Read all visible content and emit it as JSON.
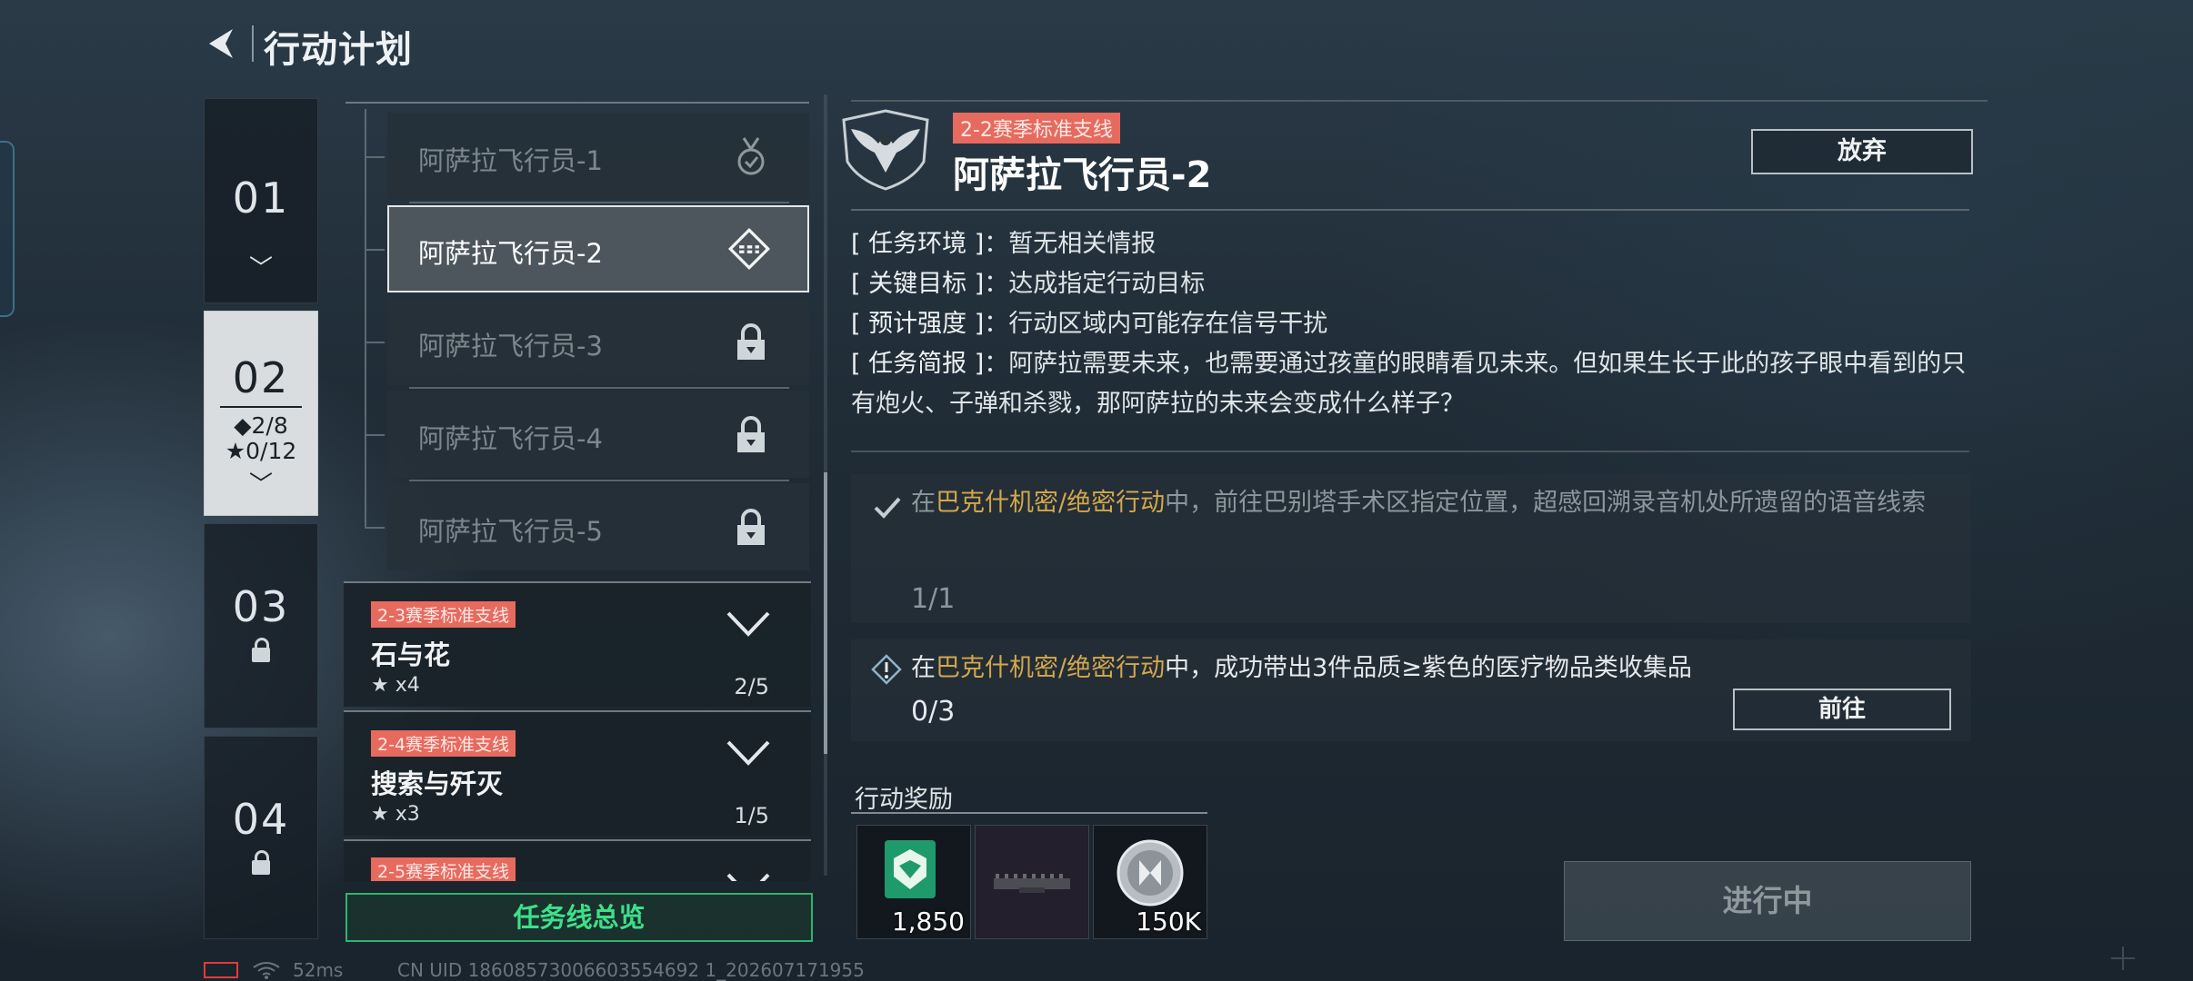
{
  "header": {
    "title": "行动计划"
  },
  "chapters": [
    {
      "num": "01",
      "state": "unlocked"
    },
    {
      "num": "02",
      "diamond": "◆2/8",
      "star": "★0/12",
      "state": "active"
    },
    {
      "num": "03",
      "state": "locked"
    },
    {
      "num": "04",
      "state": "locked"
    }
  ],
  "sub_missions": [
    {
      "label": "阿萨拉飞行员-1",
      "state": "completed"
    },
    {
      "label": "阿萨拉飞行员-2",
      "state": "selected"
    },
    {
      "label": "阿萨拉飞行员-3",
      "state": "locked"
    },
    {
      "label": "阿萨拉飞行员-4",
      "state": "locked"
    },
    {
      "label": "阿萨拉飞行员-5",
      "state": "locked"
    }
  ],
  "mission_cards": [
    {
      "tag": "2-3赛季标准支线",
      "title": "石与花",
      "stars": "★ x4",
      "progress": "2/5"
    },
    {
      "tag": "2-4赛季标准支线",
      "title": "搜索与歼灭",
      "stars": "★ x3",
      "progress": "1/5"
    },
    {
      "tag": "2-5赛季标准支线"
    }
  ],
  "overview_label": "任务线总览",
  "detail": {
    "tag": "2-2赛季标准支线",
    "title": "阿萨拉飞行员-2",
    "abandon_label": "放弃",
    "info": [
      {
        "key": "[ 任务环境 ]",
        "value": "暂无相关情报"
      },
      {
        "key": "[ 关键目标 ]",
        "value": "达成指定行动目标"
      },
      {
        "key": "[ 预计强度 ]",
        "value": "行动区域内可能存在信号干扰"
      },
      {
        "key": "[ 任务简报 ]",
        "value": "阿萨拉需要未来，也需要通过孩童的眼睛看见未来。但如果生长于此的孩子眼中看到的只有炮火、子弹和杀戮，那阿萨拉的未来会变成什么样子？"
      }
    ],
    "objectives": [
      {
        "pre": "在",
        "hl": "巴克什机密/绝密行动",
        "post": "中，前往巴别塔手术区指定位置，超感回溯录音机处所遗留的语音线索",
        "count": "1/1",
        "done": true
      },
      {
        "pre": "在",
        "hl": "巴克什机密/绝密行动",
        "post": "中，成功带出3件品质≥紫色的医疗物品类收集品",
        "count": "0/3",
        "done": false,
        "button": "前往"
      }
    ],
    "rewards_label": "行动奖励",
    "rewards": [
      {
        "icon": "green-emblem-icon",
        "amount": "1,850"
      },
      {
        "icon": "weapon-rail-icon",
        "amount": ""
      },
      {
        "icon": "silver-coin-icon",
        "amount": "150K"
      }
    ],
    "status_button": "进行中"
  },
  "status_bar": {
    "ping": "52ms",
    "uid": "CN UID 18608573006603554692 1_202607171955"
  },
  "colors": {
    "tag": "#e76a5e",
    "highlight": "#d3a74c",
    "overview": "#3de08a"
  }
}
